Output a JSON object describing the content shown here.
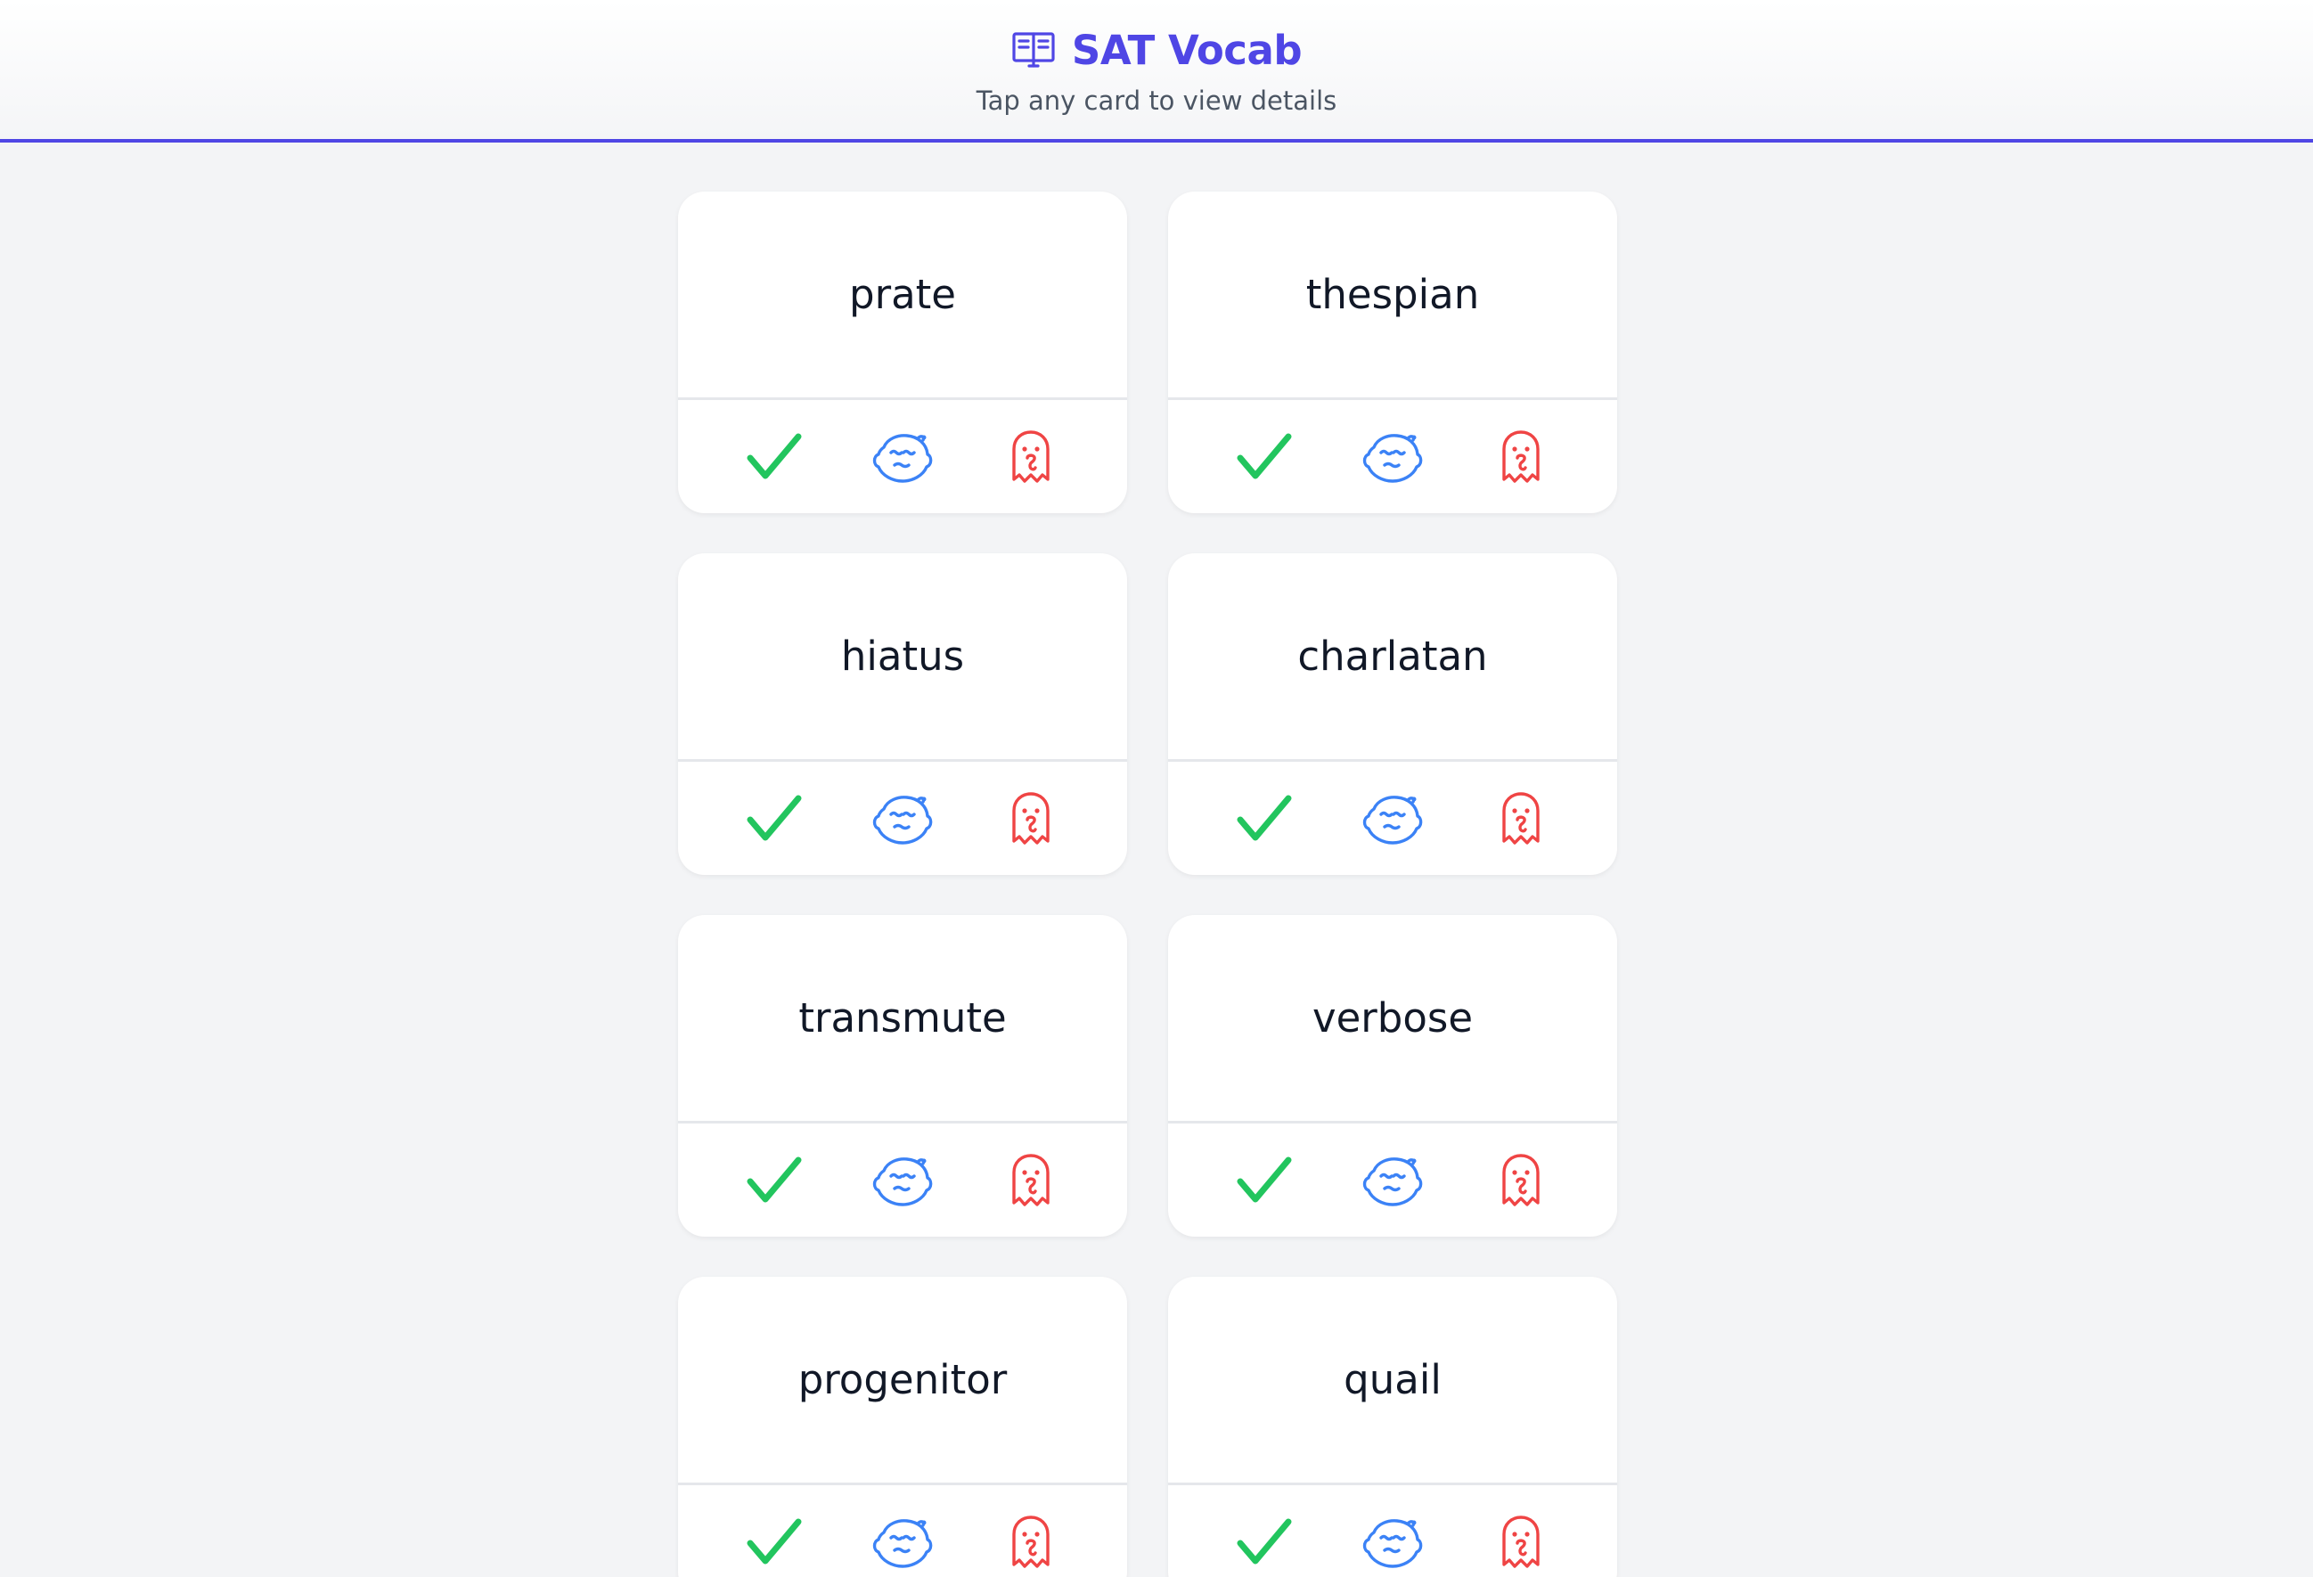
{
  "header": {
    "title": "SAT Vocab",
    "subtitle": "Tap any card to view details",
    "icon": "book-open-icon"
  },
  "colors": {
    "accent": "#4f46e5",
    "known": "#22c55e",
    "learning": "#3b82f6",
    "unknown": "#ef4444"
  },
  "cards": [
    {
      "word": "prate"
    },
    {
      "word": "thespian"
    },
    {
      "word": "hiatus"
    },
    {
      "word": "charlatan"
    },
    {
      "word": "transmute"
    },
    {
      "word": "verbose"
    },
    {
      "word": "progenitor"
    },
    {
      "word": "quail"
    }
  ],
  "actions": [
    {
      "name": "known",
      "icon": "check-icon"
    },
    {
      "name": "learning",
      "icon": "baby-face-icon"
    },
    {
      "name": "unknown",
      "icon": "ghost-icon"
    }
  ]
}
